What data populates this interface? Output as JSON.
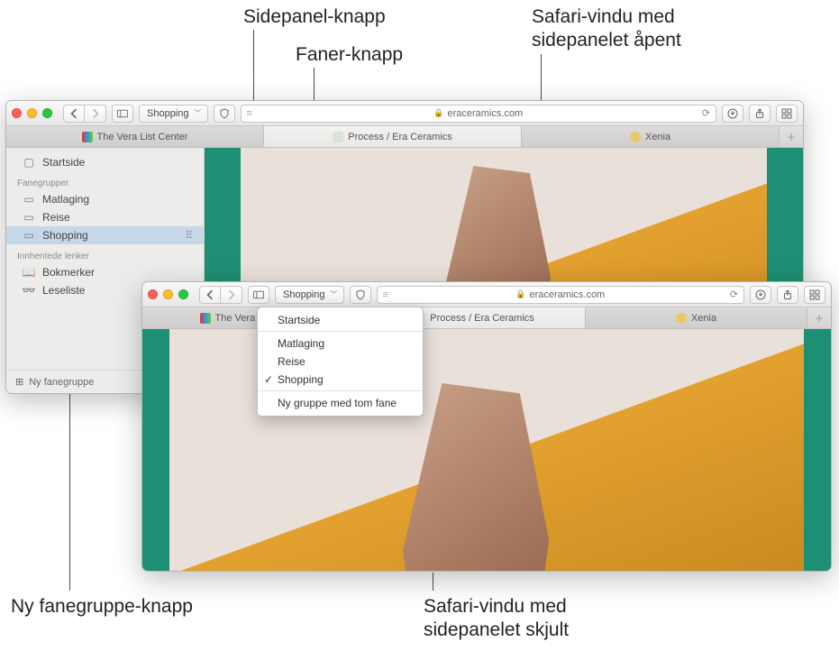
{
  "callouts": {
    "sidebar_button": "Sidepanel-knapp",
    "tabs_button": "Faner-knapp",
    "window_open": "Safari-vindu med\nsidepanelet åpent",
    "new_group_button": "Ny fanegruppe-knapp",
    "window_hidden": "Safari-vindu med\nsidepanelet skjult"
  },
  "url_host": "eraceramics.com",
  "group_button_label": "Shopping",
  "tabs": [
    {
      "label": "The Vera List Center"
    },
    {
      "label": "Process / Era Ceramics"
    },
    {
      "label": "Xenia"
    }
  ],
  "sidebar": {
    "start": "Startside",
    "groups_title": "Fanegrupper",
    "groups": [
      "Matlaging",
      "Reise",
      "Shopping"
    ],
    "links_title": "Innhentede lenker",
    "bookmarks": "Bokmerker",
    "readinglist": "Leseliste",
    "new_group": "Ny fanegruppe"
  },
  "dropdown": {
    "start": "Startside",
    "items": [
      "Matlaging",
      "Reise",
      "Shopping"
    ],
    "new_empty": "Ny gruppe med tom fane"
  }
}
